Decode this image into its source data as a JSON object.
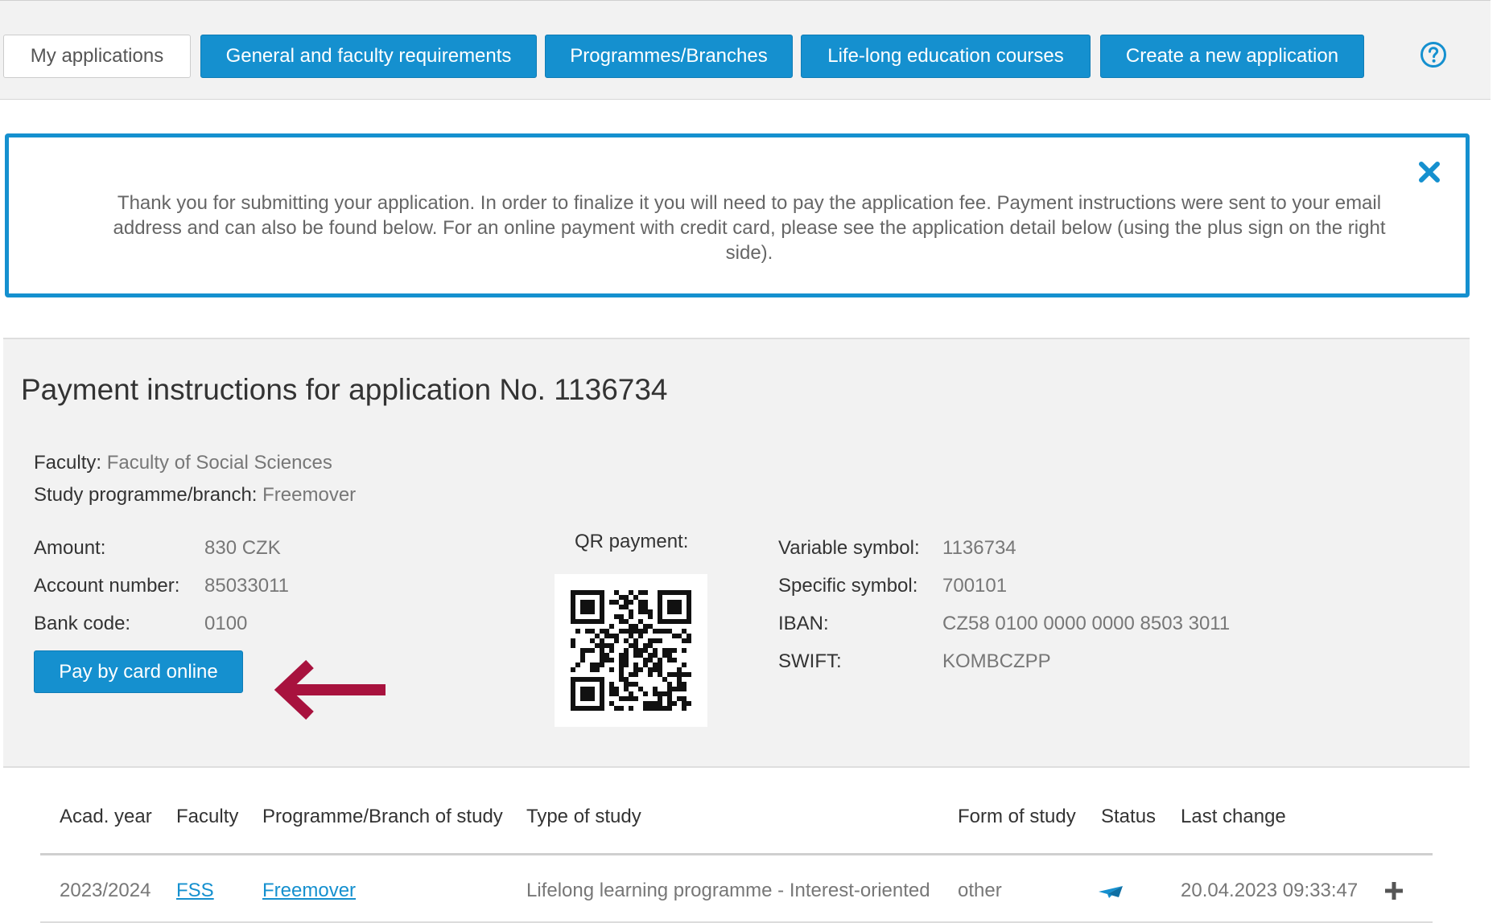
{
  "nav": {
    "my_applications": "My applications",
    "general_requirements": "General and faculty requirements",
    "programmes": "Programmes/Branches",
    "lifelong": "Life-long education courses",
    "create": "Create a new application",
    "help_icon": "question-circle-icon",
    "accent_color": "#1590cf"
  },
  "alert": {
    "text": "Thank you for submitting your application. In order to finalize it you will need to pay the application fee. Payment instructions were sent to your email address and can also be found below. For an online payment with credit card, please see the application detail below (using the plus sign on the right side).",
    "close_icon": "close-icon"
  },
  "payment": {
    "title": "Payment instructions for application No. 1136734",
    "faculty_label": "Faculty:",
    "faculty_value": "Faculty of Social Sciences",
    "programme_label": "Study programme/branch:",
    "programme_value": "Freemover",
    "amount_label": "Amount:",
    "amount_value": "830 CZK",
    "account_label": "Account number:",
    "account_value": "85033011",
    "bank_label": "Bank code:",
    "bank_value": "0100",
    "pay_button": "Pay by card online",
    "qr_label": "QR payment:",
    "variable_label": "Variable symbol:",
    "variable_value": "1136734",
    "specific_label": "Specific symbol:",
    "specific_value": "700101",
    "iban_label": "IBAN:",
    "iban_value": "CZ58 0100 0000 0000 8503 3011",
    "swift_label": "SWIFT:",
    "swift_value": "KOMBCZPP",
    "arrow_color": "#a8123e"
  },
  "table": {
    "headers": [
      "Acad. year",
      "Faculty",
      "Programme/Branch of study",
      "Type of study",
      "Form of study",
      "Status",
      "Last change"
    ],
    "row": {
      "year": "2023/2024",
      "faculty": "FSS",
      "programme": "Freemover",
      "type": "Lifelong learning programme - Interest-oriented",
      "form": "other",
      "status_icon": "paper-plane-icon",
      "last_change": "20.04.2023 09:33:47",
      "expand_icon": "plus-icon"
    }
  }
}
